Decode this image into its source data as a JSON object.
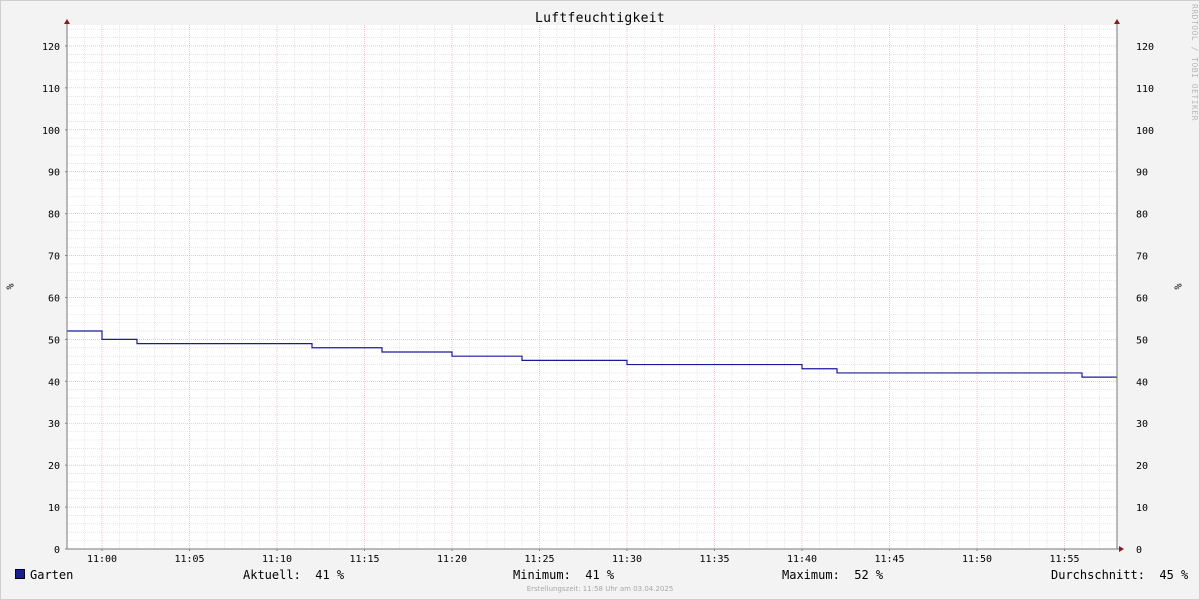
{
  "chart_data": {
    "type": "line",
    "title": "Luftfeuchtigkeit",
    "ylabel": "%",
    "ylim": [
      0,
      125
    ],
    "yticks": [
      0,
      10,
      20,
      30,
      40,
      50,
      60,
      70,
      80,
      90,
      100,
      110,
      120
    ],
    "xlim": [
      "10:58",
      "11:58"
    ],
    "xticks": [
      "11:00",
      "11:05",
      "11:10",
      "11:15",
      "11:20",
      "11:25",
      "11:30",
      "11:35",
      "11:40",
      "11:45",
      "11:50",
      "11:55"
    ],
    "grid": true,
    "series": [
      {
        "name": "Garten",
        "color": "#1a1a9c",
        "step": true,
        "x": [
          "10:58",
          "11:00",
          "11:02",
          "11:12",
          "11:16",
          "11:20",
          "11:24",
          "11:30",
          "11:40",
          "11:42",
          "11:56",
          "11:58"
        ],
        "y": [
          52,
          50,
          49,
          48,
          47,
          46,
          45,
          44,
          43,
          42,
          41,
          41
        ]
      }
    ]
  },
  "legend": {
    "series_name": "Garten",
    "current_label": "Aktuell:",
    "current_value": "41 %",
    "min_label": "Minimum:",
    "min_value": "41 %",
    "max_label": "Maximum:",
    "max_value": "52 %",
    "avg_label": "Durchschnitt:",
    "avg_value": "45 %"
  },
  "watermark": "RRDTOOL / TOBI OETIKER",
  "footer": "Erstellungszeit: 11:58 Uhr am 03.04.2025"
}
